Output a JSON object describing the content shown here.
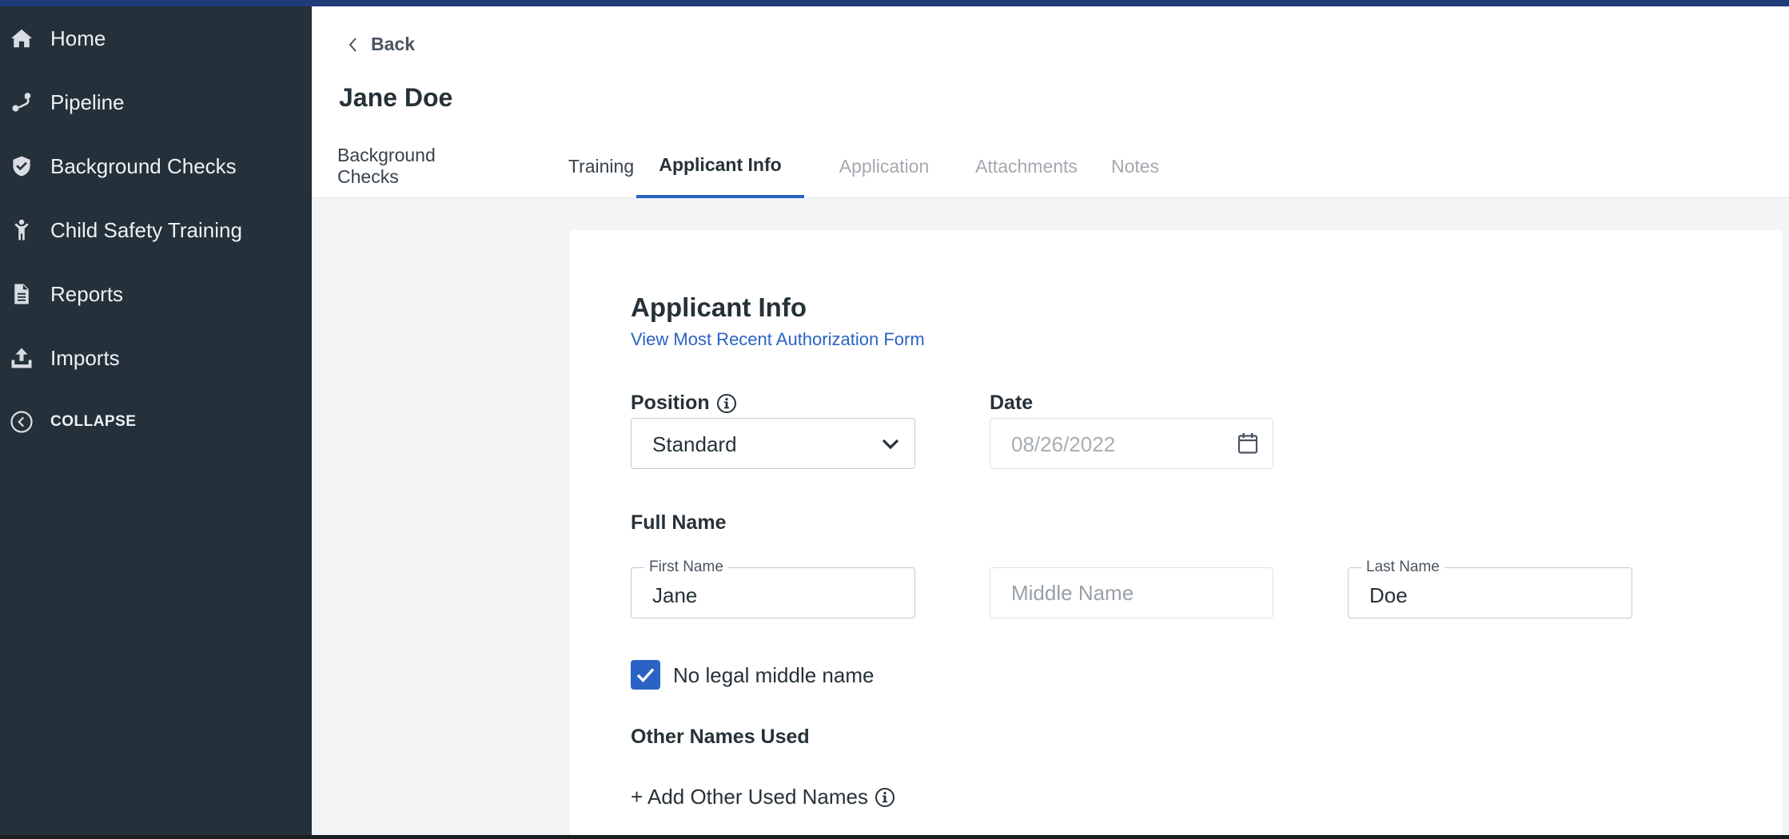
{
  "sidebar": {
    "items": [
      {
        "label": "Home",
        "icon": "home-icon"
      },
      {
        "label": "Pipeline",
        "icon": "pipeline-icon"
      },
      {
        "label": "Background Checks",
        "icon": "shield-check-icon"
      },
      {
        "label": "Child Safety Training",
        "icon": "child-icon"
      },
      {
        "label": "Reports",
        "icon": "document-icon"
      },
      {
        "label": "Imports",
        "icon": "upload-icon"
      }
    ],
    "collapse_label": "COLLAPSE"
  },
  "header": {
    "back_label": "Back",
    "title": "Jane Doe",
    "tabs": [
      {
        "label": "Background Checks",
        "state": "enabled"
      },
      {
        "label": "Training",
        "state": "enabled"
      },
      {
        "label": "Applicant Info",
        "state": "active"
      },
      {
        "label": "Application",
        "state": "disabled"
      },
      {
        "label": "Attachments",
        "state": "disabled"
      },
      {
        "label": "Notes",
        "state": "disabled"
      }
    ]
  },
  "form": {
    "section_title": "Applicant Info",
    "auth_link": "View Most Recent Authorization Form",
    "position_label": "Position",
    "position_value": "Standard",
    "date_label": "Date",
    "date_value": "08/26/2022",
    "full_name_label": "Full Name",
    "first_name_label": "First Name",
    "first_name_value": "Jane",
    "middle_name_placeholder": "Middle Name",
    "last_name_label": "Last Name",
    "last_name_value": "Doe",
    "no_middle_name_label": "No legal middle name",
    "no_middle_name_checked": true,
    "other_names_label": "Other Names Used",
    "add_other_names_label": "+ Add Other Used Names"
  },
  "colors": {
    "accent": "#2a63c4",
    "sidebar_bg": "#24303a",
    "topbar": "#1f3b78"
  }
}
